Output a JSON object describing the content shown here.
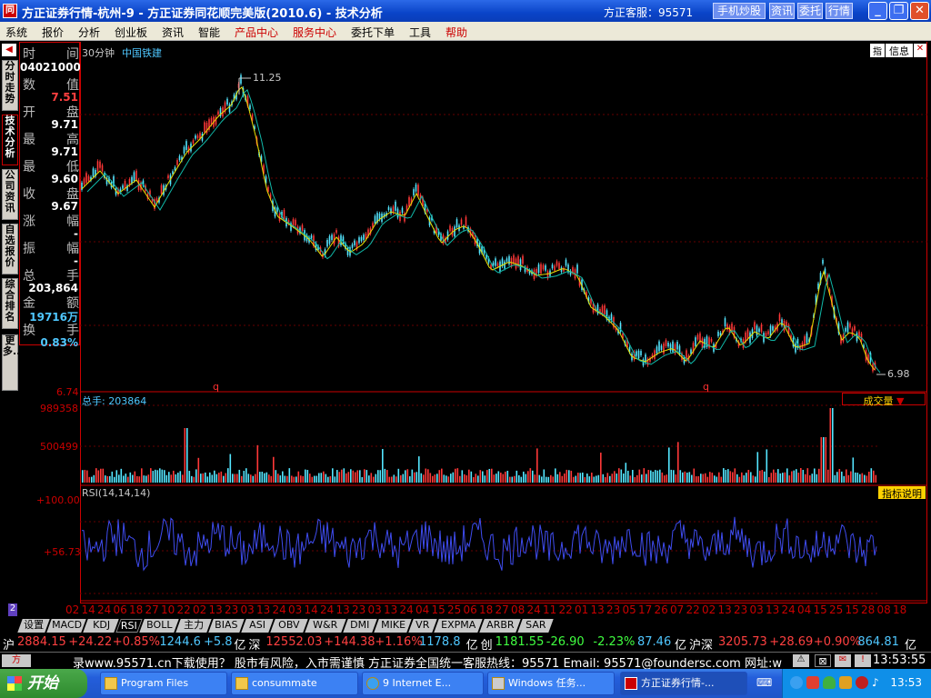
{
  "window": {
    "title": "方正证券行情-杭州-9 - 方正证券同花顺完美版(2010.6) - 技术分析",
    "customer_service": "方正客服：95571",
    "btn_mobile": "手机炒股",
    "btn_news": "资讯",
    "btn_entrust": "委托",
    "btn_quote": "行情",
    "app_icon": "同"
  },
  "menu": [
    "系统",
    "报价",
    "分析",
    "创业板",
    "资讯",
    "智能",
    "产品中心",
    "服务中心",
    "委托下单",
    "工具",
    "帮助"
  ],
  "left_tabs": [
    "分时走势",
    "技术分析",
    "公司资讯",
    "自选报价",
    "综合排名",
    "更多..."
  ],
  "info": {
    "time_label1": "时",
    "time_label2": "间",
    "time_value": "04021000",
    "rows": [
      {
        "l": "数",
        "r": "值",
        "v": "7.51",
        "c": "#ff4040"
      },
      {
        "l": "开",
        "r": "盘",
        "v": "9.71",
        "c": "#ffffff"
      },
      {
        "l": "最",
        "r": "高",
        "v": "9.71",
        "c": "#ffffff"
      },
      {
        "l": "最",
        "r": "低",
        "v": "9.60",
        "c": "#ffffff"
      },
      {
        "l": "收",
        "r": "盘",
        "v": "9.67",
        "c": "#ffffff"
      },
      {
        "l": "涨",
        "r": "幅",
        "v": "-",
        "c": "#ffffff"
      },
      {
        "l": "振",
        "r": "幅",
        "v": "-",
        "c": "#ffffff"
      },
      {
        "l": "总",
        "r": "手",
        "v": "203,864",
        "c": "#ffffff"
      },
      {
        "l": "金",
        "r": "额",
        "v": "19716万",
        "c": "#4fc7ff"
      },
      {
        "l": "换",
        "r": "手",
        "v": "0.83%",
        "c": "#4fc7ff"
      }
    ]
  },
  "chart_header": {
    "period": "30分钟",
    "stock": "中国铁建",
    "info_btn": "信息",
    "icon_btn": "指"
  },
  "price": {
    "high_label": "11.25",
    "low_label": "6.98",
    "bottom_label": "6.74"
  },
  "volume": {
    "title": "总手: 203864",
    "max": "989358",
    "mid": "500499",
    "type_select": "成交量"
  },
  "rsi": {
    "title": "RSI(14,14,14)",
    "top": "+100.00",
    "mid": "+56.73",
    "explain_btn": "指标说明"
  },
  "x_labels": [
    "02",
    "14",
    "24",
    "06",
    "18",
    "27",
    "10",
    "22",
    "02",
    "13",
    "23",
    "03",
    "13",
    "24",
    "03",
    "14",
    "24",
    "13",
    "23",
    "03",
    "13",
    "24",
    "04",
    "15",
    "25",
    "06",
    "18",
    "27",
    "08",
    "24",
    "11",
    "22",
    "01",
    "13",
    "23",
    "05",
    "17",
    "26",
    "07",
    "22",
    "02",
    "13",
    "23",
    "03",
    "13",
    "24",
    "04",
    "15",
    "25",
    "15",
    "28",
    "08",
    "18"
  ],
  "bottom_tabs": [
    "设置",
    "MACD",
    "KDJ",
    "RSI",
    "BOLL",
    "主力",
    "BIAS",
    "ASI",
    "OBV",
    "W&R",
    "DMI",
    "MIKE",
    "VR",
    "EXPMA",
    "ARBR",
    "SAR"
  ],
  "ticker": [
    {
      "t": "沪",
      "c": "#ffffff"
    },
    {
      "t": "2884.15",
      "c": "#ff4040"
    },
    {
      "t": "+24.22",
      "c": "#ff4040"
    },
    {
      "t": "+0.85%",
      "c": "#ff4040"
    },
    {
      "t": "1244.6",
      "c": "#4fc7ff"
    },
    {
      "t": "+5.8",
      "c": "#4fc7ff"
    },
    {
      "t": "亿",
      "c": "#ffffff"
    },
    {
      "t": "深",
      "c": "#ffffff"
    },
    {
      "t": "12552.03",
      "c": "#ff4040"
    },
    {
      "t": "+144.38",
      "c": "#ff4040"
    },
    {
      "t": "+1.16%",
      "c": "#ff4040"
    },
    {
      "t": "1178.8",
      "c": "#4fc7ff"
    },
    {
      "t": "亿",
      "c": "#ffffff"
    },
    {
      "t": "创",
      "c": "#ffffff"
    },
    {
      "t": "1181.55",
      "c": "#40ff40"
    },
    {
      "t": "-26.90",
      "c": "#40ff40"
    },
    {
      "t": "-2.23%",
      "c": "#40ff40"
    },
    {
      "t": "87.46",
      "c": "#4fc7ff"
    },
    {
      "t": "亿",
      "c": "#ffffff"
    },
    {
      "t": "沪深",
      "c": "#ffffff"
    },
    {
      "t": "3205.73",
      "c": "#ff4040"
    },
    {
      "t": "+28.69",
      "c": "#ff4040"
    },
    {
      "t": "+0.90%",
      "c": "#ff4040"
    },
    {
      "t": "864.81",
      "c": "#4fc7ff"
    },
    {
      "t": "亿",
      "c": "#ffffff"
    }
  ],
  "status": {
    "scroll_text": "录www.95571.cn下载使用？  股市有风险，入市需谨慎  方正证券全国统一客服热线：95571  Email: 95571@foundersc.com  网址:w",
    "time": "13:53:55"
  },
  "taskbar": {
    "start": "开始",
    "items": [
      "Program Files",
      "consummate",
      "9 Internet E...",
      "Windows 任务...",
      "方正证券行情-..."
    ],
    "clock": "13:53"
  },
  "colors": {
    "red": "#c00000",
    "cyan": "#4fc7ff",
    "ma_green": "#10b8a8",
    "ma_yellow": "#e8e000",
    "rsi_blue": "#3f4cf0"
  }
}
